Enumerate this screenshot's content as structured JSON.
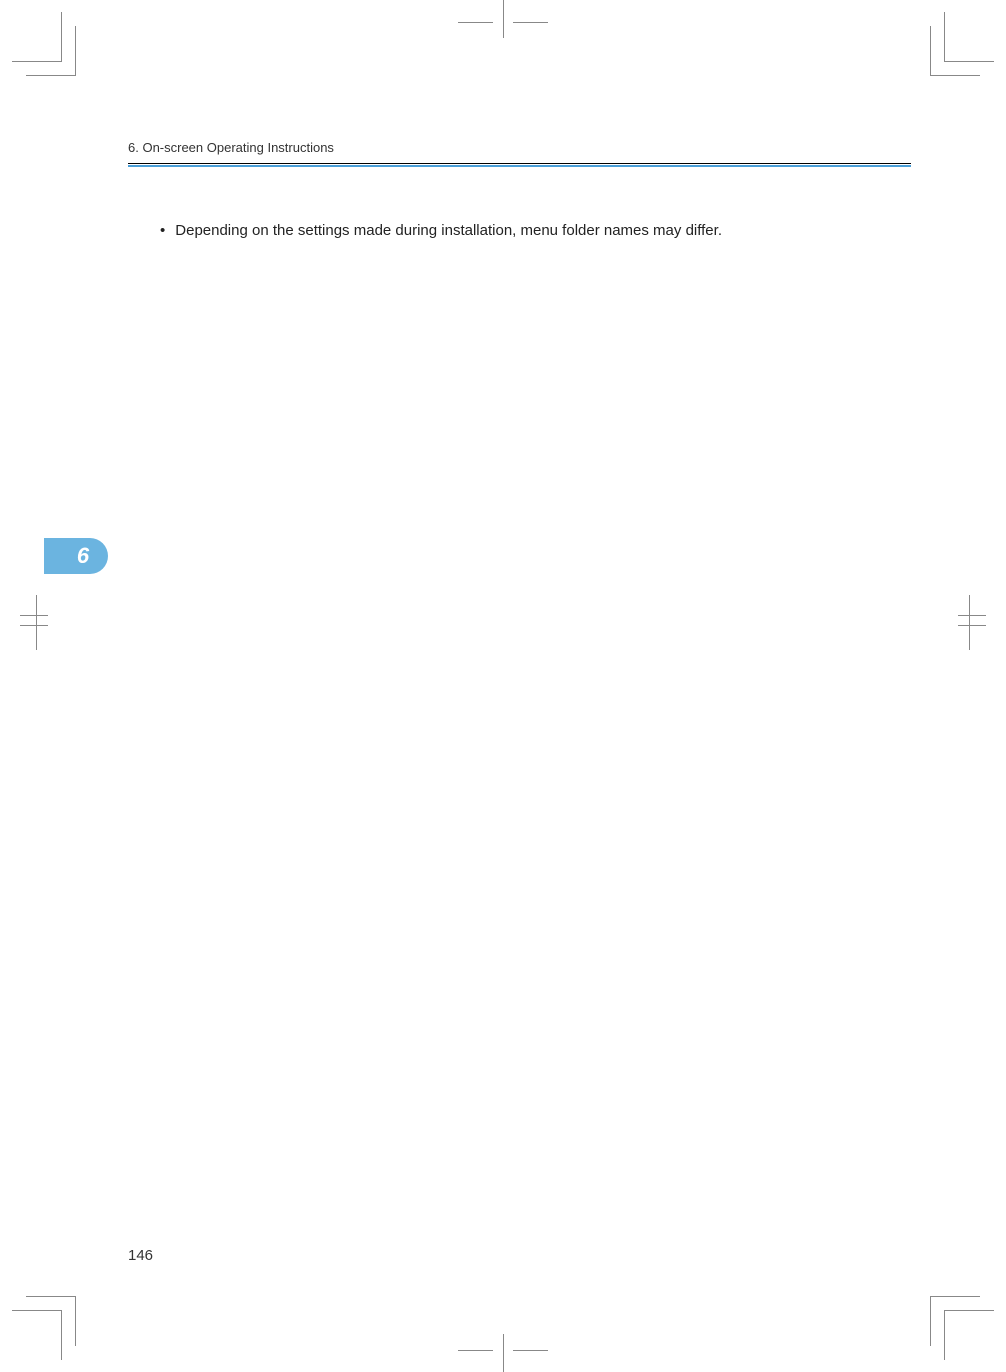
{
  "header": {
    "section_title": "6. On-screen Operating Instructions"
  },
  "content": {
    "bullet": "•",
    "text": "Depending on the settings made during installation, menu folder names may differ."
  },
  "chapter_tab": {
    "number": "6"
  },
  "page_number": "146",
  "colors": {
    "accent_blue": "#4a9fd8",
    "tab_blue": "#6bb4e0"
  }
}
